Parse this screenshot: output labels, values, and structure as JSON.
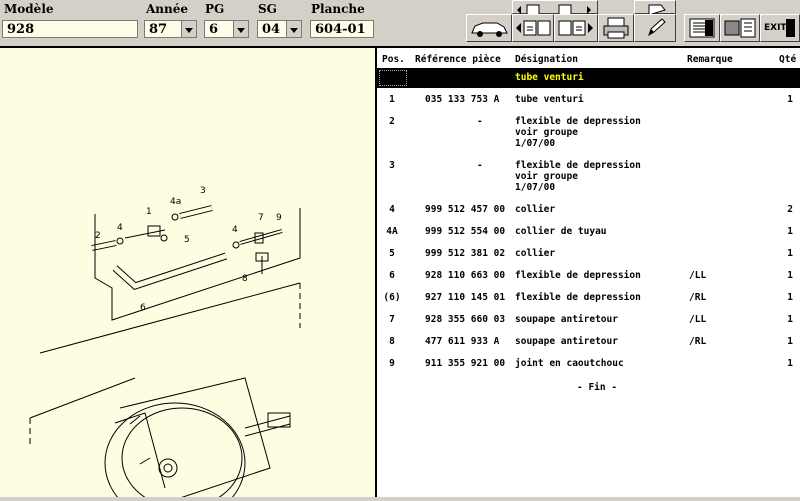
{
  "toolbar": {
    "modele_label": "Modèle",
    "modele_value": "928",
    "annee_label": "Année",
    "annee_value": "87",
    "pg_label": "PG",
    "pg_value": "6",
    "sg_label": "SG",
    "sg_value": "04",
    "planche_label": "Planche",
    "planche_value": "604-01",
    "exit_label": "EXIT"
  },
  "list": {
    "headers": {
      "pos": "Pos.",
      "ref": "Référence pièce",
      "des": "Désignation",
      "rem": "Remarque",
      "qty": "Qté"
    },
    "group_title": "tube venturi",
    "rows": [
      {
        "pos": "1",
        "ref": "035 133 753 A",
        "des": [
          "tube venturi"
        ],
        "rem": "",
        "qty": "1"
      },
      {
        "pos": "2",
        "ref": "-",
        "des": [
          "flexible de depression",
          "voir groupe",
          "1/07/00"
        ],
        "rem": "",
        "qty": ""
      },
      {
        "pos": "3",
        "ref": "-",
        "des": [
          "flexible de depression",
          "voir groupe",
          "1/07/00"
        ],
        "rem": "",
        "qty": ""
      },
      {
        "pos": "4",
        "ref": "999 512 457 00",
        "des": [
          "collier"
        ],
        "rem": "",
        "qty": "2"
      },
      {
        "pos": "4A",
        "ref": "999 512 554 00",
        "des": [
          "collier de tuyau"
        ],
        "rem": "",
        "qty": "1"
      },
      {
        "pos": "5",
        "ref": "999 512 381 02",
        "des": [
          "collier"
        ],
        "rem": "",
        "qty": "1"
      },
      {
        "pos": "6",
        "ref": "928 110 663 00",
        "des": [
          "flexible de depression"
        ],
        "rem": "/LL",
        "qty": "1"
      },
      {
        "pos": "(6)",
        "ref": "927 110 145 01",
        "des": [
          "flexible de depression"
        ],
        "rem": "/RL",
        "qty": "1"
      },
      {
        "pos": "7",
        "ref": "928 355 660 03",
        "des": [
          "soupape antiretour"
        ],
        "rem": "/LL",
        "qty": "1"
      },
      {
        "pos": "8",
        "ref": "477 611 933 A",
        "des": [
          "soupape antiretour"
        ],
        "rem": "/RL",
        "qty": "1"
      },
      {
        "pos": "9",
        "ref": "911 355 921 00",
        "des": [
          "joint en caoutchouc"
        ],
        "rem": "",
        "qty": "1"
      }
    ],
    "fin": "- Fin -"
  },
  "drawing": {
    "callouts": [
      "1",
      "2",
      "3",
      "4",
      "4a",
      "5",
      "4",
      "7",
      "9",
      "6",
      "8"
    ]
  }
}
